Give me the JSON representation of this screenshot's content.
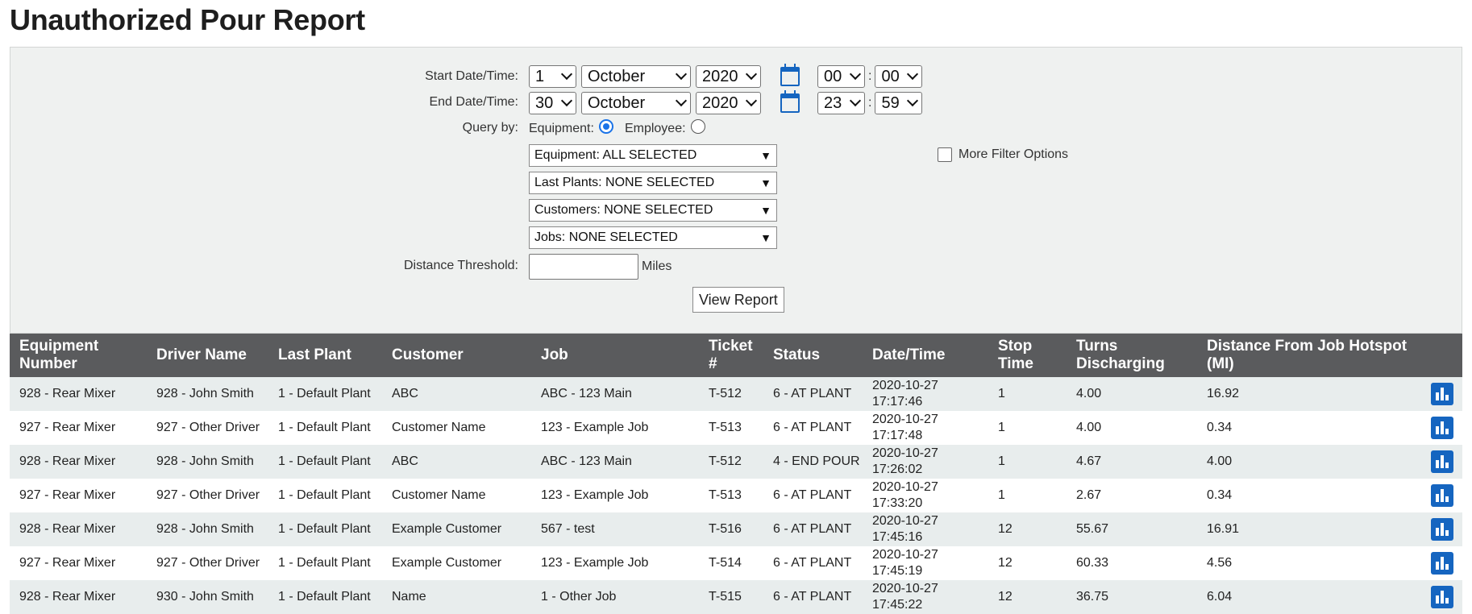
{
  "page": {
    "title": "Unauthorized Pour Report"
  },
  "filters": {
    "start_label": "Start Date/Time:",
    "start": {
      "day": "1",
      "month": "October",
      "year": "2020",
      "hour": "00",
      "minute": "00"
    },
    "end_label": "End Date/Time:",
    "end": {
      "day": "30",
      "month": "October",
      "year": "2020",
      "hour": "23",
      "minute": "59"
    },
    "colon": ":",
    "query_label": "Query by:",
    "equipment_radio_label": "Equipment:",
    "employee_radio_label": "Employee:",
    "equipment_dropdown": "Equipment: ALL SELECTED",
    "plants_dropdown": "Last Plants: NONE SELECTED",
    "customers_dropdown": "Customers: NONE SELECTED",
    "jobs_dropdown": "Jobs: NONE SELECTED",
    "dropdown_arrow": "▼",
    "more_filter_label": "More Filter Options",
    "distance_label": "Distance Threshold:",
    "distance_value": "",
    "distance_unit": "Miles",
    "view_button": "View Report"
  },
  "table": {
    "headers": {
      "equipment": [
        "Equipment",
        "Number"
      ],
      "driver": "Driver Name",
      "plant": "Last Plant",
      "customer": "Customer",
      "job": "Job",
      "ticket": [
        "Ticket",
        "#"
      ],
      "status": "Status",
      "datetime": "Date/Time",
      "stop": [
        "Stop",
        "Time"
      ],
      "turns": [
        "Turns",
        "Discharging"
      ],
      "distance": [
        "Distance From Job Hotspot",
        "(MI)"
      ]
    },
    "rows": [
      {
        "equipment": "928 -  Rear Mixer",
        "driver": "928 - John Smith",
        "plant": "1 - Default Plant",
        "customer": "ABC",
        "job": "ABC - 123 Main",
        "ticket": "T-512",
        "status": "6 - AT PLANT",
        "date": "2020-10-27",
        "time": "17:17:46",
        "stop": "1",
        "turns": "4.00",
        "distance": "16.92"
      },
      {
        "equipment": "927 -  Rear Mixer",
        "driver": "927 - Other Driver",
        "plant": "1 - Default Plant",
        "customer": "Customer Name",
        "job": "123 - Example Job",
        "ticket": "T-513",
        "status": "6 - AT PLANT",
        "date": "2020-10-27",
        "time": "17:17:48",
        "stop": "1",
        "turns": "4.00",
        "distance": "0.34"
      },
      {
        "equipment": "928 -  Rear Mixer",
        "driver": "928 - John Smith",
        "plant": "1 - Default Plant",
        "customer": "ABC",
        "job": "ABC - 123 Main",
        "ticket": "T-512",
        "status": "4 - END POUR",
        "date": "2020-10-27",
        "time": "17:26:02",
        "stop": "1",
        "turns": "4.67",
        "distance": "4.00"
      },
      {
        "equipment": "927 -  Rear Mixer",
        "driver": "927 - Other Driver",
        "plant": "1 - Default Plant",
        "customer": "Customer Name",
        "job": "123 - Example Job",
        "ticket": "T-513",
        "status": "6 - AT PLANT",
        "date": "2020-10-27",
        "time": "17:33:20",
        "stop": "1",
        "turns": "2.67",
        "distance": "0.34"
      },
      {
        "equipment": "928 -  Rear Mixer",
        "driver": "928 - John Smith",
        "plant": "1 - Default Plant",
        "customer": "Example Customer",
        "job": "567 - test",
        "ticket": "T-516",
        "status": "6 - AT PLANT",
        "date": "2020-10-27",
        "time": "17:45:16",
        "stop": "12",
        "turns": "55.67",
        "distance": "16.91"
      },
      {
        "equipment": "927 -  Rear Mixer",
        "driver": "927 - Other Driver",
        "plant": "1 - Default Plant",
        "customer": "Example Customer",
        "job": "123 - Example Job",
        "ticket": "T-514",
        "status": "6 - AT PLANT",
        "date": "2020-10-27",
        "time": "17:45:19",
        "stop": "12",
        "turns": "60.33",
        "distance": "4.56"
      },
      {
        "equipment": "928 -  Rear Mixer",
        "driver": "930 - John Smith",
        "plant": "1 - Default Plant",
        "customer": "Name",
        "job": "1 -  Other Job",
        "ticket": "T-515",
        "status": "6 - AT PLANT",
        "date": "2020-10-27",
        "time": "17:45:22",
        "stop": "12",
        "turns": "36.75",
        "distance": "6.04"
      }
    ],
    "row_icon": "bar-chart-icon"
  },
  "colors": {
    "header_bg": "#5a5b5d",
    "accent": "#1565c0",
    "panel_bg": "#eff1f0",
    "alt_row": "#e8eded"
  }
}
